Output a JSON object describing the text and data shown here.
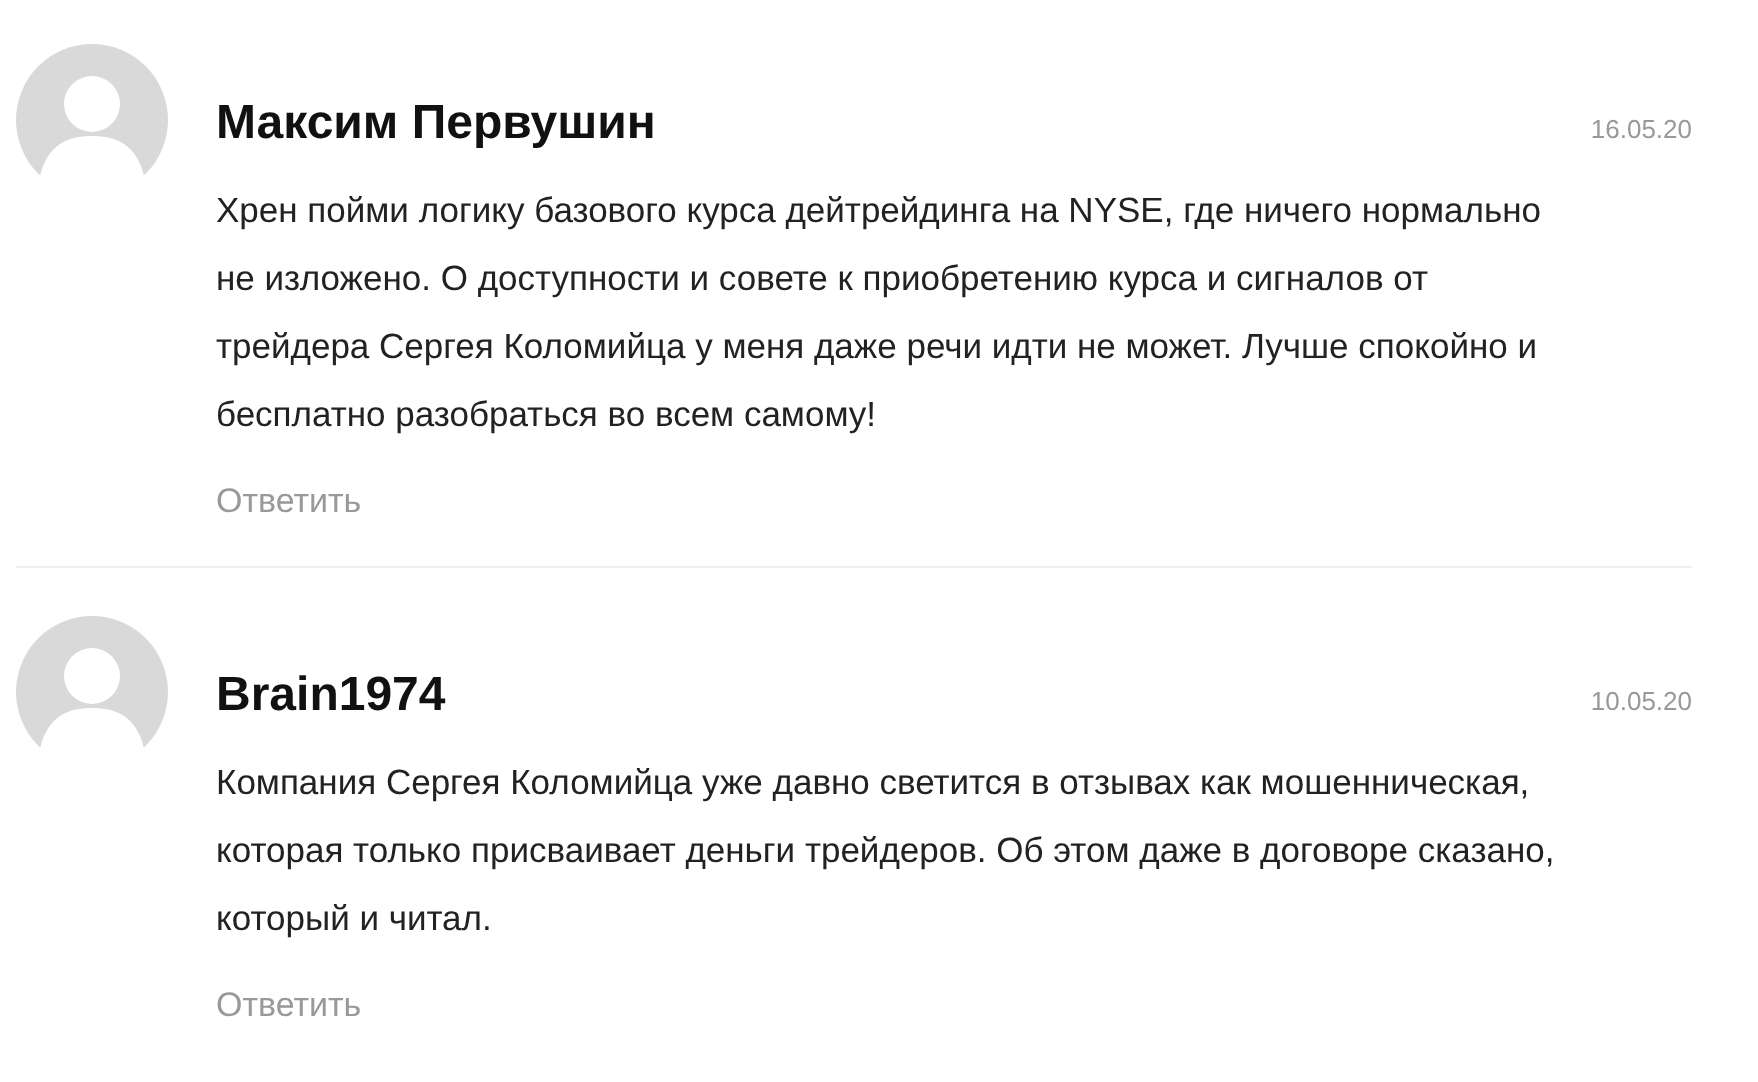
{
  "comments": [
    {
      "author": "Максим Первушин",
      "date": "16.05.20",
      "text": "Хрен пойми логику базового курса дейтрейдинга на NYSE, где ничего нормально не изложено. О доступности и совете к приобретению курса и сигналов от трейдера Сергея Коломийца у меня даже речи идти не может. Лучше спокойно и бесплатно разобраться во всем самому!",
      "reply": "Ответить"
    },
    {
      "author": "Brain1974",
      "date": "10.05.20",
      "text": "Компания Сергея Коломийца уже давно светится в отзывах как мошенническая, которая только присваивает деньги трейдеров. Об этом даже в договоре сказано, который и читал.",
      "reply": "Ответить"
    }
  ]
}
